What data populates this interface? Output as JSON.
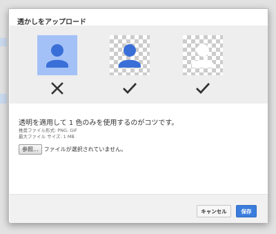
{
  "dialog": {
    "title": "透かしをアップロード",
    "tip": "透明を適用して 1 色のみを使用するのがコツです。",
    "formats_line": "推奨ファイル形式: PNG, GIF",
    "size_line": "最大ファイル サイズ: 1 MB",
    "browse_label": "参照...",
    "no_file_text": "ファイルが選択されていません。",
    "cancel_label": "キャンセル",
    "save_label": "保存"
  },
  "examples": [
    {
      "icon": "person-icon",
      "background": "solid-blue",
      "verdict": "cross-icon"
    },
    {
      "icon": "person-icon",
      "background": "transparent",
      "verdict": "check-icon"
    },
    {
      "icon": "person-icon",
      "background": "transparent",
      "verdict": "check-icon"
    }
  ],
  "colors": {
    "accent": "#3b7ddd",
    "person_blue": "#3a6fd8",
    "tile_blue": "#a3c1f7",
    "person_white": "#ffffff"
  }
}
